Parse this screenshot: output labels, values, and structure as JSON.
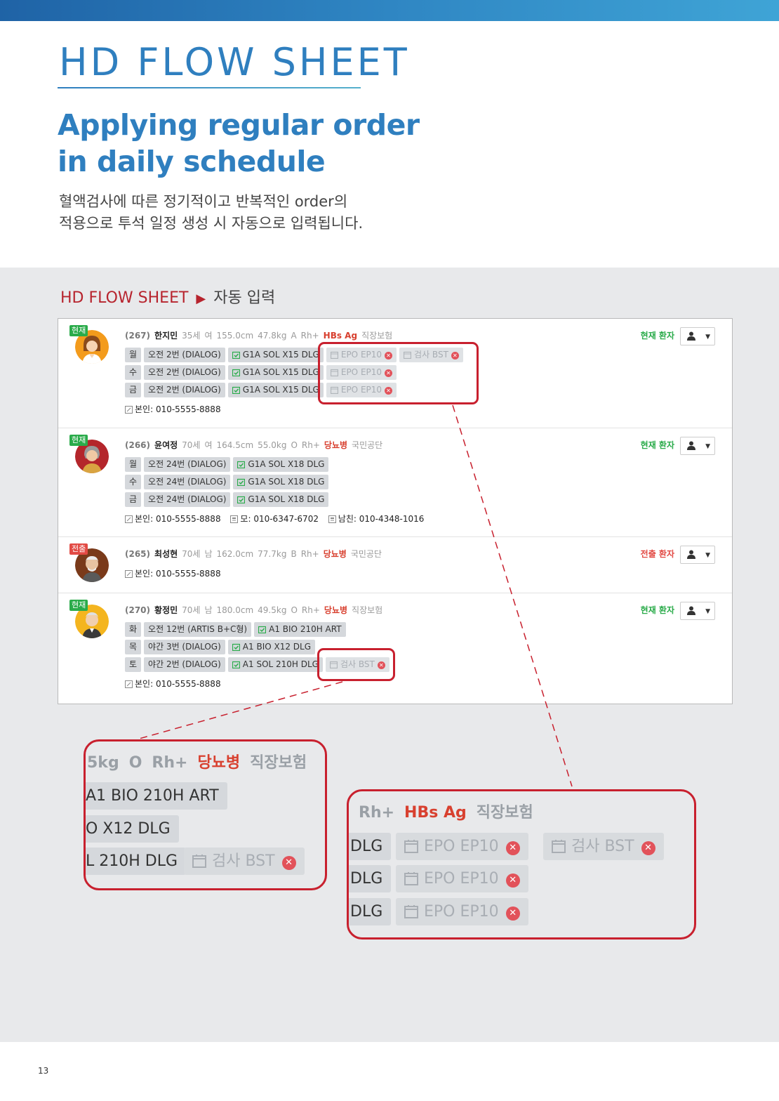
{
  "header": {
    "doc_title": "HD FLOW SHEET",
    "headline_line1": "Applying regular order",
    "headline_line2": "in daily schedule",
    "desc_line1": "혈액검사에 따른 정기적이고 반복적인 order의",
    "desc_line2": "적용으로 투석 일정 생성 시 자동으로 입력됩니다."
  },
  "section": {
    "label": "HD FLOW SHEET",
    "arrow": "▶",
    "after": "자동 입력"
  },
  "patients": [
    {
      "badge": "현재",
      "id": "(267)",
      "name": "한지민",
      "age": "35세",
      "sex": "여",
      "height": "155.0cm",
      "weight": "47.8kg",
      "blood": "A",
      "rh": "Rh+",
      "disease": "HBs Ag",
      "insurance": "직장보험",
      "status": "현재 환자",
      "schedule": [
        {
          "day": "월",
          "session": "오전 2번 (DIALOG)",
          "order": "G1A SOL X15 DLG",
          "extras": [
            "EPO EP10",
            "검사 BST"
          ]
        },
        {
          "day": "수",
          "session": "오전 2번 (DIALOG)",
          "order": "G1A SOL X15 DLG",
          "extras": [
            "EPO EP10"
          ]
        },
        {
          "day": "금",
          "session": "오전 2번 (DIALOG)",
          "order": "G1A SOL X15 DLG",
          "extras": [
            "EPO EP10"
          ]
        }
      ],
      "contacts": [
        "본인: 010-5555-8888"
      ]
    },
    {
      "badge": "현재",
      "id": "(266)",
      "name": "윤여정",
      "age": "70세",
      "sex": "여",
      "height": "164.5cm",
      "weight": "55.0kg",
      "blood": "O",
      "rh": "Rh+",
      "disease": "당뇨병",
      "insurance": "국민공단",
      "status": "현재 환자",
      "schedule": [
        {
          "day": "월",
          "session": "오전 24번 (DIALOG)",
          "order": "G1A SOL X18 DLG",
          "extras": []
        },
        {
          "day": "수",
          "session": "오전 24번 (DIALOG)",
          "order": "G1A SOL X18 DLG",
          "extras": []
        },
        {
          "day": "금",
          "session": "오전 24번 (DIALOG)",
          "order": "G1A SOL X18 DLG",
          "extras": []
        }
      ],
      "contacts": [
        "본인: 010-5555-8888",
        "모: 010-6347-6702",
        "남친: 010-4348-1016"
      ]
    },
    {
      "badge": "전출",
      "id": "(265)",
      "name": "최성현",
      "age": "70세",
      "sex": "남",
      "height": "162.0cm",
      "weight": "77.7kg",
      "blood": "B",
      "rh": "Rh+",
      "disease": "당뇨병",
      "insurance": "국민공단",
      "status": "전출 환자",
      "schedule": [],
      "contacts": [
        "본인: 010-5555-8888"
      ]
    },
    {
      "badge": "현재",
      "id": "(270)",
      "name": "황정민",
      "age": "70세",
      "sex": "남",
      "height": "180.0cm",
      "weight": "49.5kg",
      "blood": "O",
      "rh": "Rh+",
      "disease": "당뇨병",
      "insurance": "직장보험",
      "status": "현재 환자",
      "schedule": [
        {
          "day": "화",
          "session": "오전 12번 (ARTIS B+C형)",
          "order": "A1 BIO 210H ART",
          "extras": []
        },
        {
          "day": "목",
          "session": "야간 3번 (DIALOG)",
          "order": "A1 BIO X12 DLG",
          "extras": []
        },
        {
          "day": "토",
          "session": "야간 2번 (DIALOG)",
          "order": "A1 SOL 210H DLG",
          "extras": [
            "검사 BST"
          ]
        }
      ],
      "contacts": [
        "본인: 010-5555-8888"
      ]
    }
  ],
  "zoom_left": {
    "info": [
      "5kg",
      "O",
      "Rh+",
      "당뇨병",
      "직장보험"
    ],
    "rows": [
      "A1 BIO 210H ART",
      "O X12 DLG",
      "L 210H DLG"
    ],
    "extra": "검사 BST"
  },
  "zoom_right": {
    "info": [
      "Rh+",
      "HBs Ag",
      "직장보험"
    ],
    "rows": [
      "DLG",
      "DLG",
      "DLG"
    ],
    "extras_row1": [
      "EPO EP10",
      "검사 BST"
    ],
    "extras_row2": [
      "EPO EP10"
    ],
    "extras_row3": [
      "EPO EP10"
    ]
  },
  "colors": {
    "brand_blue": "#2f7fbf",
    "accent_red": "#c8202e",
    "status_green": "#2aab4a",
    "status_red": "#e24a44"
  },
  "icons": {
    "calendar": "calendar-icon",
    "calendar_check": "calendar-check-icon",
    "user": "user-icon",
    "remove": "remove-circle-icon",
    "phone": "phone-icon",
    "contact_card": "contact-card-icon"
  },
  "page_number": "13"
}
